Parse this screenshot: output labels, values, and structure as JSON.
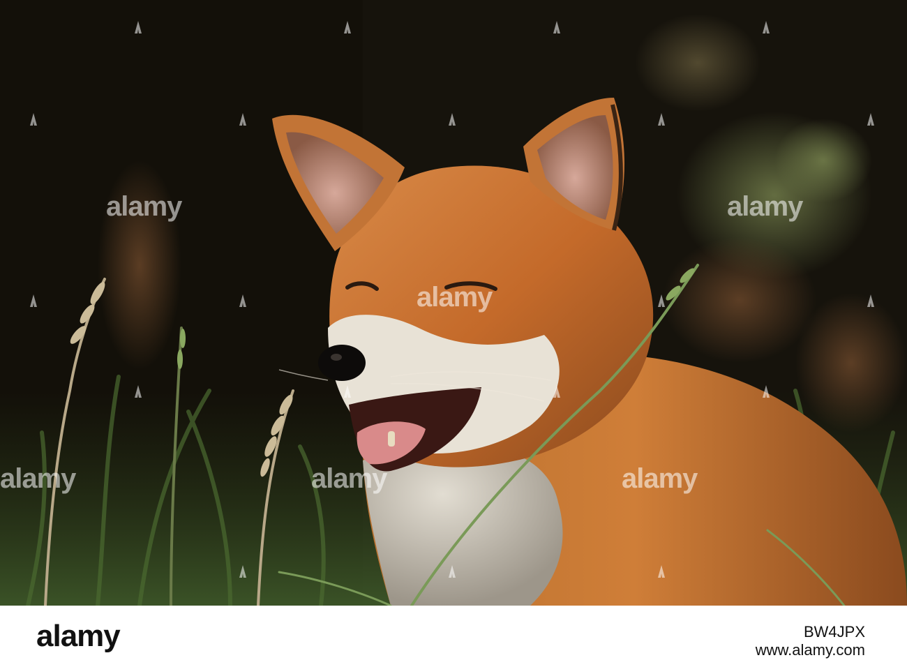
{
  "photo": {
    "subject": "red fox",
    "palette": {
      "background": "#16130c",
      "fur": "#c46a2a",
      "fur_light": "#e39a5a",
      "muzzle": "#e8e2d6",
      "chest": "#c9c3b8",
      "nose": "#0d0b0a",
      "tongue": "#d98a8a",
      "grass": "#3f5a2a"
    },
    "watermark_text": "alamy"
  },
  "footer": {
    "logo": "alamy",
    "image_id": "BW4JPX",
    "site": "www.alamy.com"
  }
}
